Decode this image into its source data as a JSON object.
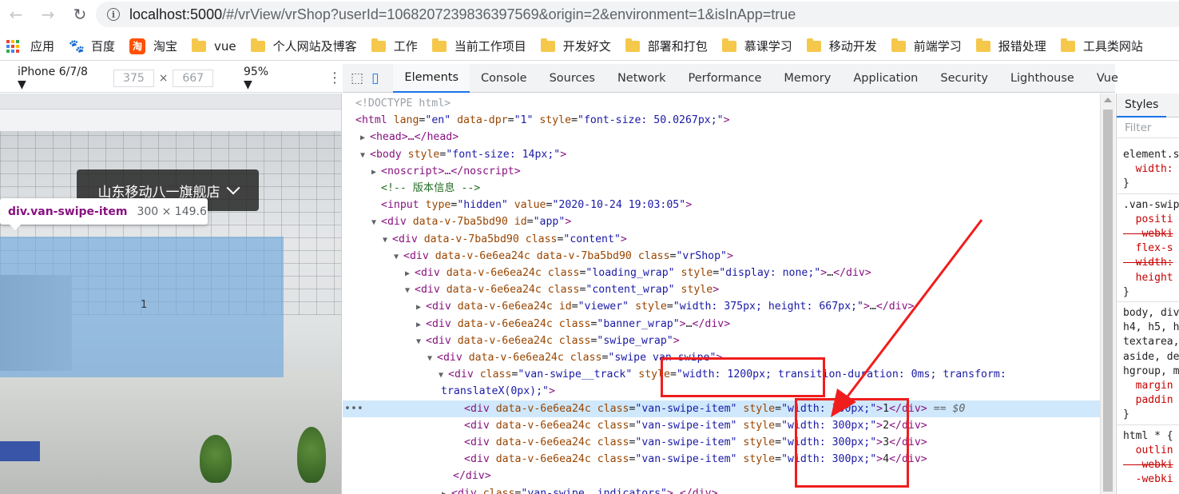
{
  "browser": {
    "url_host": "localhost:5000",
    "url_rest": "/#/vrView/vrShop?userId=1068207239836397569&origin=2&environment=1&isInApp=true",
    "bookmarks": [
      {
        "label": "应用",
        "icon": "apps-grid-icon"
      },
      {
        "label": "百度",
        "icon": "baidu-icon"
      },
      {
        "label": "淘宝",
        "icon": "taobao-icon"
      },
      {
        "label": "vue",
        "icon": "folder-icon"
      },
      {
        "label": "个人网站及博客",
        "icon": "folder-icon"
      },
      {
        "label": "工作",
        "icon": "folder-icon"
      },
      {
        "label": "当前工作项目",
        "icon": "folder-icon"
      },
      {
        "label": "开发好文",
        "icon": "folder-icon"
      },
      {
        "label": "部署和打包",
        "icon": "folder-icon"
      },
      {
        "label": "慕课学习",
        "icon": "folder-icon"
      },
      {
        "label": "移动开发",
        "icon": "folder-icon"
      },
      {
        "label": "前端学习",
        "icon": "folder-icon"
      },
      {
        "label": "报错处理",
        "icon": "folder-icon"
      },
      {
        "label": "工具类网站",
        "icon": "folder-icon"
      }
    ]
  },
  "device_toolbar": {
    "device": "iPhone 6/7/8 ▼",
    "width": "375",
    "height": "667",
    "x": "×",
    "zoom": "95% ▼"
  },
  "viewport": {
    "shop_name": "山东移动八一旗舰店",
    "tooltip_selector": "div.van-swipe-item",
    "tooltip_size": "300 × 149.6",
    "slide_number": "1"
  },
  "devtools": {
    "tabs": [
      "Elements",
      "Console",
      "Sources",
      "Network",
      "Performance",
      "Memory",
      "Application",
      "Security",
      "Lighthouse",
      "Vue"
    ],
    "active_tab": "Elements",
    "styles_tab": "Styles",
    "filter_placeholder": "Filter"
  },
  "tree": {
    "l0": "<!DOCTYPE html>",
    "l1_tag_open": "<html",
    "l1_attrs": [
      [
        "lang",
        "\"en\""
      ],
      [
        "data-dpr",
        "\"1\""
      ],
      [
        "style",
        "\"font-size: 50.0267px;\""
      ]
    ],
    "l2": "<head>…</head>",
    "l3_style": "\"font-size: 14px;\"",
    "l4": "<noscript>…</noscript>",
    "l5_comment": "<!-- 版本信息 -->",
    "l6_type": "\"hidden\"",
    "l6_value": "\"2020-10-24 19:03:05\"",
    "l7_attr": "data-v-7ba5bd90",
    "l7_id": "\"app\"",
    "l8_class": "\"content\"",
    "l9_class": "\"vrShop\"",
    "l10_class": "\"loading_wrap\"",
    "l10_style": "\"display: none;\"",
    "l11_class": "\"content_wrap\"",
    "l12_id": "\"viewer\"",
    "l12_style": "\"width: 375px; height: 667px;\"",
    "l13_class": "\"banner_wrap\"",
    "l14_class": "\"swipe_wrap\"",
    "l15_class": "\"swipe van-swipe\"",
    "l16_class": "\"van-swipe__track\"",
    "l16_style_a": "\"width: 1200px; transition-duration: 0ms; transform:",
    "l16_style_b": "translateX(0px);\"",
    "item_class": "\"van-swipe-item\"",
    "item_style": "\"width: 300px;\"",
    "items": [
      "1",
      "2",
      "3",
      "4"
    ],
    "selected_marker": "== $0",
    "close_div": "</div>",
    "l22_class": "\"van-swipe__indicators\""
  },
  "styles_pane": {
    "lines": [
      {
        "text": "element.s",
        "kind": "selector"
      },
      {
        "text": "  width:",
        "kind": "prop"
      },
      {
        "text": "}",
        "kind": "selector"
      },
      {
        "text": ".van-swip",
        "kind": "selector"
      },
      {
        "text": "  positi",
        "kind": "prop"
      },
      {
        "text": "  -webki",
        "kind": "strike"
      },
      {
        "text": "  flex-s",
        "kind": "prop"
      },
      {
        "text": "  width:",
        "kind": "strike"
      },
      {
        "text": "  height",
        "kind": "prop"
      },
      {
        "text": "}",
        "kind": "selector"
      },
      {
        "text": "body, div",
        "kind": "selector"
      },
      {
        "text": "h4, h5, h",
        "kind": "selector"
      },
      {
        "text": "textarea,",
        "kind": "selector"
      },
      {
        "text": "aside, de",
        "kind": "selector"
      },
      {
        "text": "hgroup, m",
        "kind": "selector"
      },
      {
        "text": "  margin",
        "kind": "prop"
      },
      {
        "text": "  paddin",
        "kind": "prop"
      },
      {
        "text": "}",
        "kind": "selector"
      },
      {
        "text": "html * {",
        "kind": "selector"
      },
      {
        "text": "  outlin",
        "kind": "prop"
      },
      {
        "text": "  -webki",
        "kind": "strike"
      },
      {
        "text": "  -webki",
        "kind": "prop"
      }
    ]
  },
  "colors": {
    "annotation_red": "#f01d1d",
    "selection_blue": "#cfe8fc",
    "highlight_overlay": "#6fa8dc"
  }
}
